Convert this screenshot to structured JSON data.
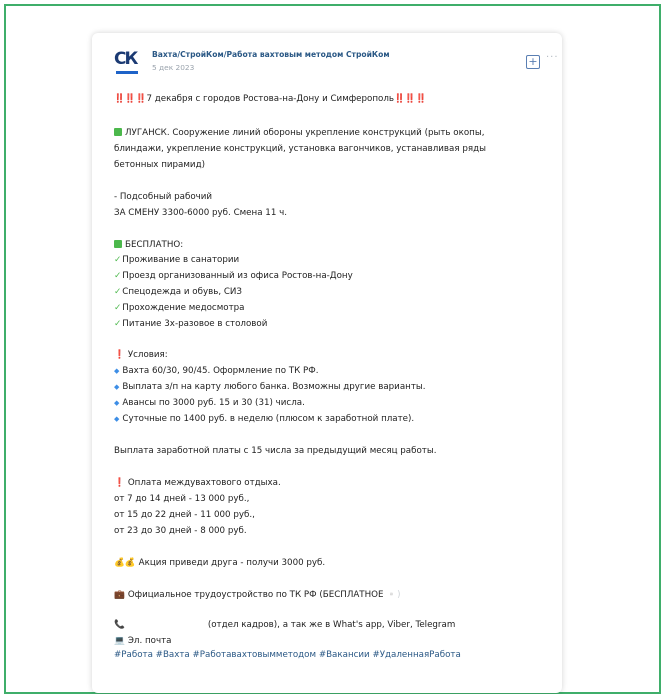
{
  "post": {
    "author": "Вахта/СтройКом/Работа вахтовым методом СтройКом",
    "date": "5 дек 2023",
    "avatar_text": "СК",
    "headline": {
      "prefix": "‼️‼️‼️",
      "text": "7 декабря с городов Ростова-на-Дону и Симферополь",
      "suffix": "‼️‼️‼️"
    },
    "intro": [
      "ЛУГАНСК. Сооружение линий обороны укрепление конструкций (рыть окопы,",
      "блиндажи, укрепление конструкций, установка вагончиков, устанавливая ряды",
      "бетонных пирамид)"
    ],
    "job": {
      "title": "- Подсобный рабочий",
      "pay": "ЗА СМЕНУ 3300-6000 руб. Смена 11 ч."
    },
    "free": {
      "title": "БЕСПЛАТНО:",
      "items": [
        "Проживание в санатории",
        "Проезд организованный из офиса Ростов-на-Дону",
        "Спецодежда и обувь, СИЗ",
        "Прохождение медосмотра",
        "Питание 3х-разовое в столовой"
      ]
    },
    "conditions": {
      "title": "Условия:",
      "items": [
        "Вахта 60/30, 90/45. Оформление по ТК РФ.",
        "Выплата з/п на карту любого банка. Возможны другие варианты.",
        "Авансы по 3000 руб. 15 и 30 (31) числа.",
        "Суточные по 1400 руб. в неделю (плюсом к заработной плате)."
      ]
    },
    "salary_note": "Выплата заработной платы с 15 числа за предыдущий месяц работы.",
    "rest_pay": {
      "title": "Оплата междувахтового отдыха.",
      "items": [
        "от 7 до 14 дней - 13 000 руб.,",
        "от 15 до 22 дней - 11 000 руб.,",
        "от 23 до 30 дней - 8 000 руб."
      ]
    },
    "promo": "Акция приведи друга - получи 3000 руб.",
    "official": "Официальное трудоустройство по ТК РФ (БЕСПЛАТНОЕ",
    "contact": "(отдел кадров), а так же в What's app, Viber, Telegram",
    "email_label": "Эл. почта",
    "hashtags": "#Работа #Вахта #Работавахтовымметодом #Вакансии #УдаленнаяРабота"
  },
  "colors": {
    "frame_border": "#3fae6a",
    "link": "#2a5885",
    "accent_red": "#e8332b",
    "accent_green": "#4cb84c",
    "accent_blue": "#3d8ee6"
  },
  "icons": {
    "plus": "plus-square-icon",
    "more": "more-dots-icon"
  }
}
